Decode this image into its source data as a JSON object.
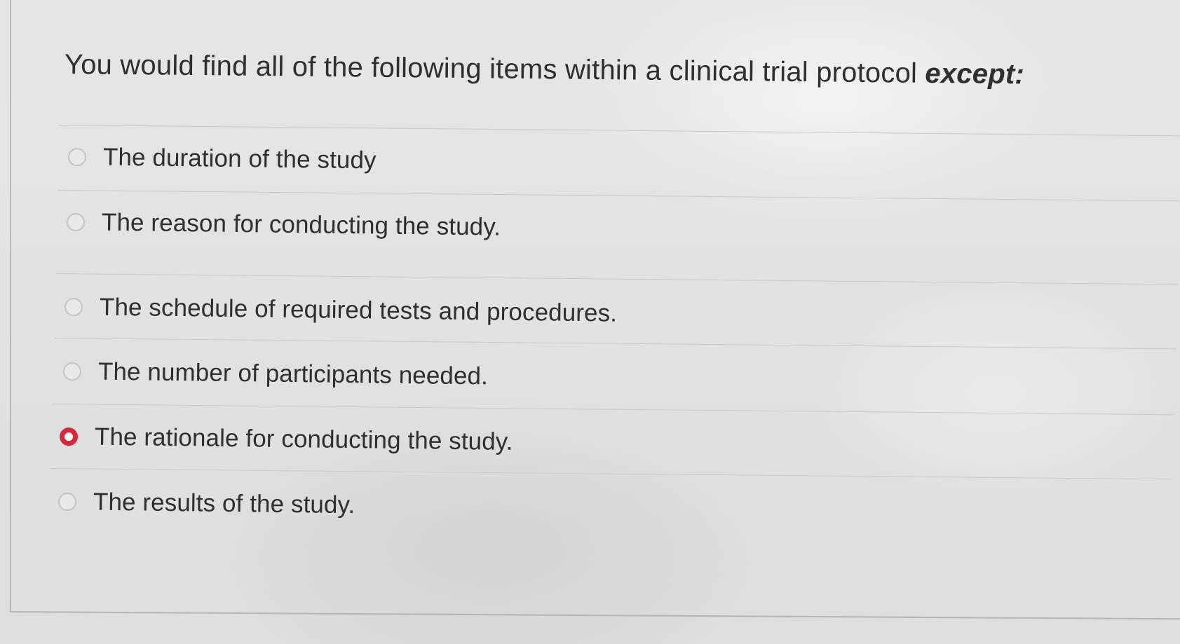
{
  "question": {
    "text": "You would find all of the following items within a clinical trial protocol ",
    "emphasis": "except:"
  },
  "options": [
    {
      "label": "The duration of the study",
      "selected": false
    },
    {
      "label": "The reason for conducting the study.",
      "selected": false
    },
    {
      "label": "The schedule of required tests and procedures.",
      "selected": false
    },
    {
      "label": "The number of participants needed.",
      "selected": false
    },
    {
      "label": "The rationale for conducting the study.",
      "selected": true
    },
    {
      "label": "The results of the study.",
      "selected": false
    }
  ],
  "colors": {
    "selected_radio": "#d8283c",
    "text": "#2f2f2f"
  }
}
